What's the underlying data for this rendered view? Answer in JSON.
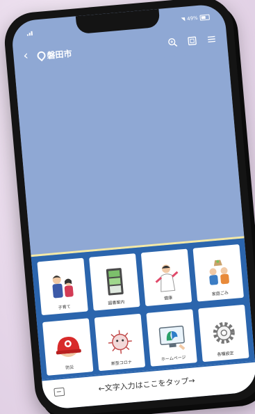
{
  "status": {
    "battery": "49%"
  },
  "header": {
    "city": "磐田市",
    "back_icon": "chevron-left-icon",
    "search_icon": "zoom-icon",
    "view_icon": "square-icon",
    "menu_icon": "hamburger-icon"
  },
  "tiles": [
    {
      "label": "子育て",
      "icon": "parent-child-icon"
    },
    {
      "label": "図書案内",
      "icon": "book-shelf-icon"
    },
    {
      "label": "健康",
      "icon": "health-icon"
    },
    {
      "label": "家庭ごみ",
      "icon": "garbage-icon"
    },
    {
      "label": "防災",
      "icon": "helmet-icon"
    },
    {
      "label": "新型コロナ",
      "icon": "virus-icon"
    },
    {
      "label": "ホームページ",
      "icon": "homepage-icon"
    },
    {
      "label": "各種設定",
      "icon": "settings-icon"
    }
  ],
  "input": {
    "prompt": "←文字入力はここをタップ→"
  },
  "colors": {
    "screen": "#8fa8d4",
    "grid": "#2b65ad",
    "accent": "#f4e9a6"
  }
}
